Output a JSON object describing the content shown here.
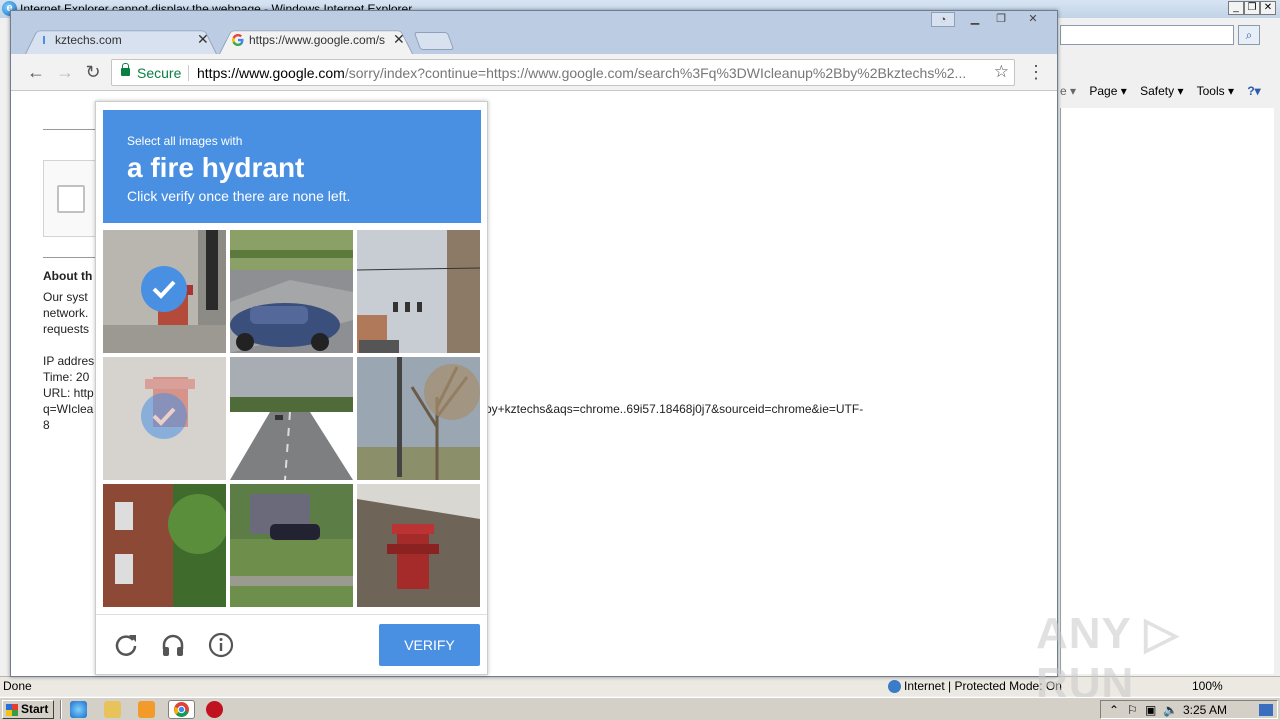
{
  "ie": {
    "title": "Internet Explorer cannot display the webpage - Windows Internet Explorer",
    "command_bar": [
      "Page ▾",
      "Safety ▾",
      "Tools ▾"
    ],
    "status_text": "Done",
    "zone_text": "Internet | Protected Mode: On",
    "zoom_text": "100%"
  },
  "chrome": {
    "tabs": [
      {
        "label": "kztechs.com"
      },
      {
        "label": "https://www.google.com/se"
      }
    ],
    "omnibox": {
      "secure_label": "Secure",
      "url_host": "https://www.google.com",
      "url_rest": "/sorry/index?continue=https://www.google.com/search%3Fq%3DWIcleanup%2Bby%2Bkztechs%2..."
    }
  },
  "page": {
    "about_heading": "About th",
    "lines": [
      "Our syst",
      "network.",
      "requests",
      "",
      "IP addres",
      "Time: 20",
      "URL: http",
      "q=WIclea",
      "8"
    ],
    "url_tail": "oy+kztechs&aqs=chrome..69i57.18468j0j7&sourceid=chrome&ie=UTF-"
  },
  "captcha": {
    "instruction_small": "Select all images with",
    "instruction_big": "a fire hydrant",
    "instruction_sub": "Click verify once there are none left.",
    "tiles": [
      {
        "name": "tile-hydrant-sidewalk",
        "selected": true
      },
      {
        "name": "tile-car-street",
        "selected": false
      },
      {
        "name": "tile-traffic-lights",
        "selected": false
      },
      {
        "name": "tile-hydrant-faded",
        "selected": true
      },
      {
        "name": "tile-highway",
        "selected": false
      },
      {
        "name": "tile-bare-tree",
        "selected": false
      },
      {
        "name": "tile-brick-house",
        "selected": false
      },
      {
        "name": "tile-house-lawn",
        "selected": false
      },
      {
        "name": "tile-hydrant-red",
        "selected": false
      }
    ],
    "verify_label": "VERIFY"
  },
  "watermark": "ANY ▷ RUN",
  "taskbar": {
    "start_label": "Start",
    "clock": "3:25 AM"
  },
  "colors": {
    "captcha_blue": "#4a90e2",
    "secure_green": "#0b8043"
  }
}
